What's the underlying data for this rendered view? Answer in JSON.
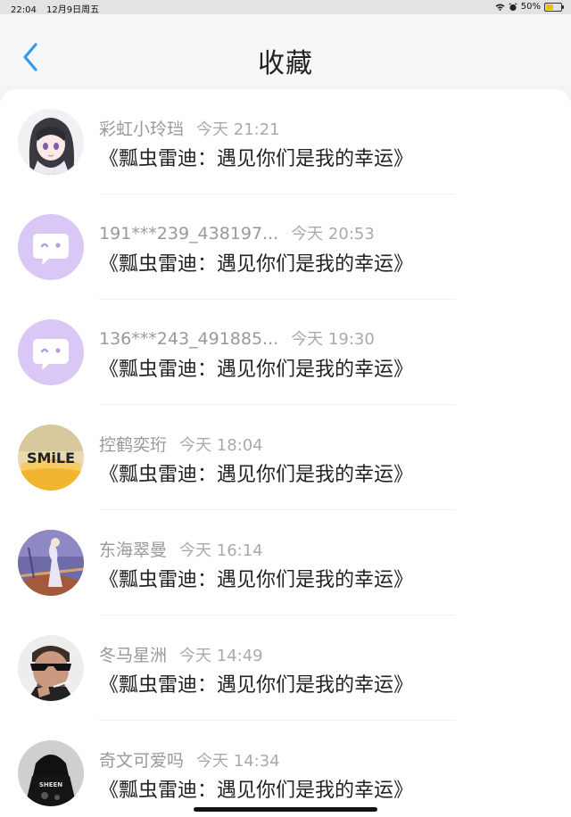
{
  "status_bar": {
    "time": "22:04",
    "date": "12月9日周五",
    "battery": "50%",
    "battery_level": 0.5
  },
  "header": {
    "title": "收藏"
  },
  "colors": {
    "accent": "#2f9bef",
    "avatar_purple": "#d9c8f5"
  },
  "favorites": [
    {
      "user": "彩虹小玲珰",
      "time": "今天 21:21",
      "title": "《瓢虫雷迪：遇见你们是我的幸运》",
      "avatar": "anime-girl"
    },
    {
      "user": "191***239_438197...",
      "time": "今天 20:53",
      "title": "《瓢虫雷迪：遇见你们是我的幸运》",
      "avatar": "default-chat-bubble"
    },
    {
      "user": "136***243_491885...",
      "time": "今天 19:30",
      "title": "《瓢虫雷迪：遇见你们是我的幸运》",
      "avatar": "default-chat-bubble"
    },
    {
      "user": "控鹤奕珩",
      "time": "今天 18:04",
      "title": "《瓢虫雷迪：遇见你们是我的幸运》",
      "avatar": "smile-cup"
    },
    {
      "user": "东海翠曼",
      "time": "今天 16:14",
      "title": "《瓢虫雷迪：遇见你们是我的幸运》",
      "avatar": "anime-scene"
    },
    {
      "user": "冬马星洲",
      "time": "今天 14:49",
      "title": "《瓢虫雷迪：遇见你们是我的幸运》",
      "avatar": "man-sunglasses"
    },
    {
      "user": "奇文可爱吗",
      "time": "今天 14:34",
      "title": "《瓢虫雷迪：遇见你们是我的幸运》",
      "avatar": "black-hoodie"
    }
  ]
}
